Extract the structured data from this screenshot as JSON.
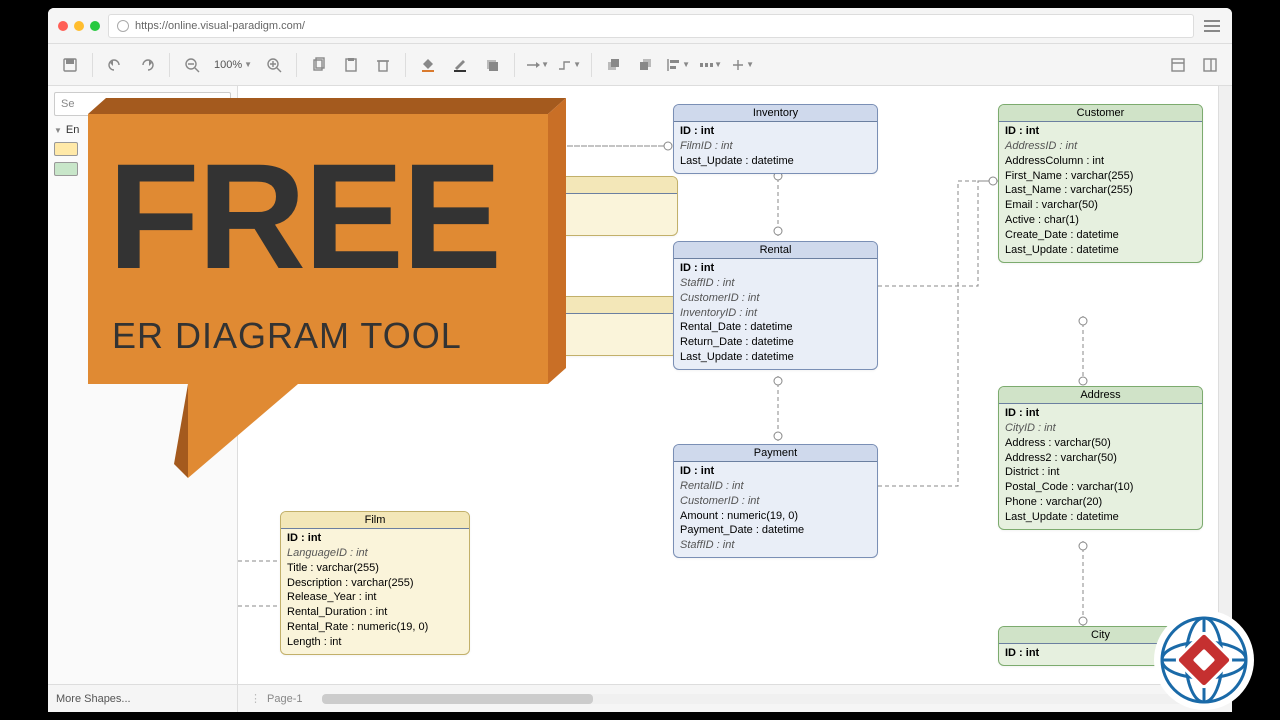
{
  "browser": {
    "url": "https://online.visual-paradigm.com/"
  },
  "toolbar": {
    "zoom": "100%"
  },
  "sidebar": {
    "search_placeholder": "Se",
    "category": "En",
    "more_shapes": "More Shapes..."
  },
  "tabs": {
    "page1": "Page-1"
  },
  "banner": {
    "headline": "FREE",
    "subline": "ER DIAGRAM TOOL"
  },
  "entities": {
    "film": {
      "title": "Film",
      "rows": [
        {
          "label": "ID : int",
          "style": "pk"
        },
        {
          "label": "LanguageID : int",
          "style": "fk"
        },
        {
          "label": "Title : varchar(255)"
        },
        {
          "label": "Description : varchar(255)"
        },
        {
          "label": "Release_Year : int"
        },
        {
          "label": "Rental_Duration : int"
        },
        {
          "label": "Rental_Rate : numeric(19, 0)"
        },
        {
          "label": "Length : int"
        }
      ]
    },
    "inventory": {
      "title": "Inventory",
      "rows": [
        {
          "label": "ID : int",
          "style": "pk"
        },
        {
          "label": "FilmID : int",
          "style": "fk"
        },
        {
          "label": "Last_Update : datetime"
        }
      ]
    },
    "rental": {
      "title": "Rental",
      "rows": [
        {
          "label": "ID : int",
          "style": "pk"
        },
        {
          "label": "StaffID : int",
          "style": "fk"
        },
        {
          "label": "CustomerID : int",
          "style": "fk"
        },
        {
          "label": "InventoryID : int",
          "style": "fk"
        },
        {
          "label": "Rental_Date : datetime"
        },
        {
          "label": "Return_Date : datetime"
        },
        {
          "label": "Last_Update : datetime"
        }
      ]
    },
    "payment": {
      "title": "Payment",
      "rows": [
        {
          "label": "ID : int",
          "style": "pk"
        },
        {
          "label": "RentalID : int",
          "style": "fk"
        },
        {
          "label": "CustomerID : int",
          "style": "fk"
        },
        {
          "label": "Amount : numeric(19, 0)"
        },
        {
          "label": "Payment_Date : datetime"
        },
        {
          "label": "StaffID : int",
          "style": "fk"
        }
      ]
    },
    "customer": {
      "title": "Customer",
      "rows": [
        {
          "label": "ID : int",
          "style": "pk"
        },
        {
          "label": "AddressID : int",
          "style": "fk"
        },
        {
          "label": "AddressColumn : int"
        },
        {
          "label": "First_Name : varchar(255)"
        },
        {
          "label": "Last_Name : varchar(255)"
        },
        {
          "label": "Email : varchar(50)"
        },
        {
          "label": "Active : char(1)"
        },
        {
          "label": "Create_Date : datetime"
        },
        {
          "label": "Last_Update : datetime"
        }
      ]
    },
    "address": {
      "title": "Address",
      "rows": [
        {
          "label": "ID : int",
          "style": "pk"
        },
        {
          "label": "CityID : int",
          "style": "fk"
        },
        {
          "label": "Address : varchar(50)"
        },
        {
          "label": "Address2 : varchar(50)"
        },
        {
          "label": "District : int"
        },
        {
          "label": "Postal_Code : varchar(10)"
        },
        {
          "label": "Phone : varchar(20)"
        },
        {
          "label": "Last_Update : datetime"
        }
      ]
    },
    "city": {
      "title": "City",
      "rows": [
        {
          "label": "ID : int",
          "style": "pk"
        }
      ]
    }
  }
}
